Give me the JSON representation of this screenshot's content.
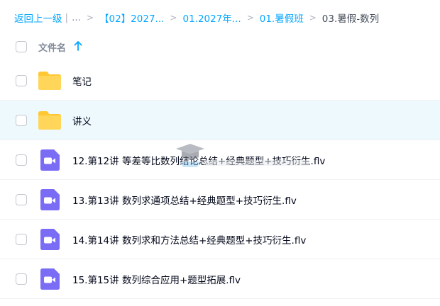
{
  "breadcrumb": {
    "back": "返回上一级",
    "ellipsis": "...",
    "items": [
      "【02】2027...",
      "01.2027年...",
      "01.暑假班"
    ],
    "current": "03.暑假-数列"
  },
  "header": {
    "column_label": "文件名"
  },
  "files": [
    {
      "name": "笔记",
      "type": "folder"
    },
    {
      "name": "讲义",
      "type": "folder"
    },
    {
      "name": "12.第12讲 等差等比数列结论总结+经典题型+技巧衍生.flv",
      "type": "video"
    },
    {
      "name": "13.第13讲 数列求通项总结+经典题型+技巧衍生.flv",
      "type": "video"
    },
    {
      "name": "14.第14讲 数列求和方法总结+经典题型+技巧衍生.flv",
      "type": "video"
    },
    {
      "name": "15.第15讲 数列综合应用+题型拓展.flv",
      "type": "video"
    }
  ],
  "colors": {
    "accent": "#06a7ff",
    "folder": "#ffd659",
    "video": "#7b6cf6",
    "highlight_row": "#eef9fe"
  }
}
